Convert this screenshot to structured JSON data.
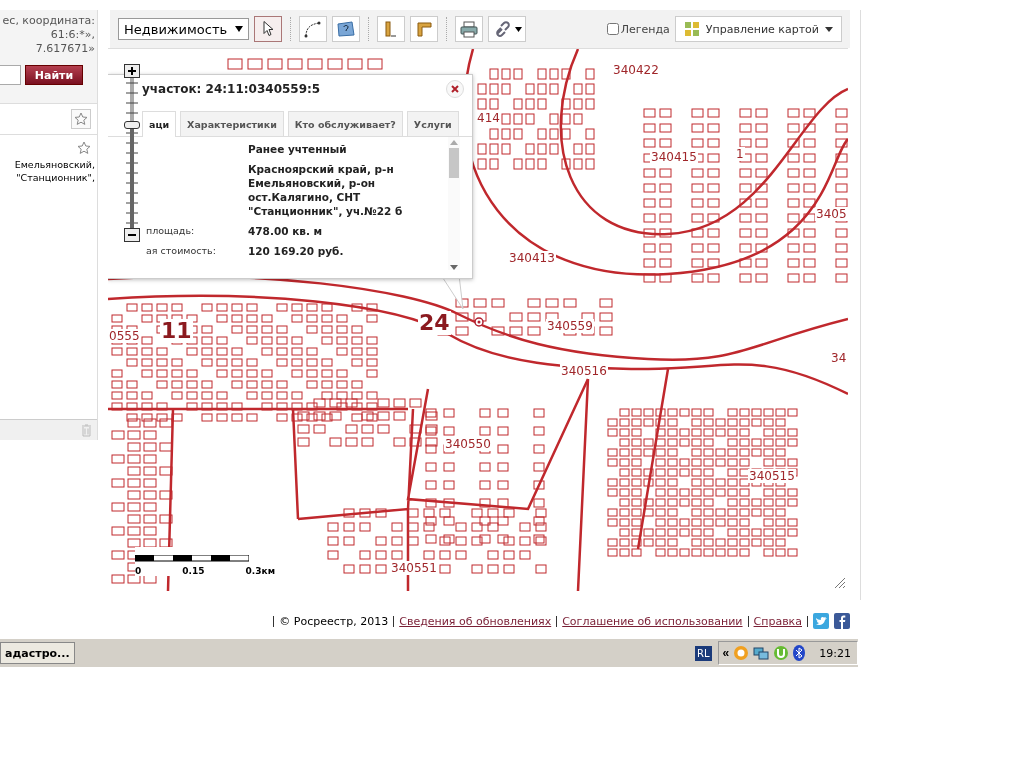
{
  "left_panel": {
    "hint_lines": [
      "ес, координата:",
      "61:6:*»,",
      "7.617671»"
    ],
    "search_button": "Найти",
    "result_lines": [
      "Емельяновский,",
      "\"Станционник\","
    ]
  },
  "toolbar": {
    "layer_select": "Недвижимость",
    "legend": {
      "label": "Легенда",
      "checked": false
    },
    "map_control": "Управление картой"
  },
  "map": {
    "labels": [
      {
        "text": "340422",
        "kind": "block"
      },
      {
        "text": "414",
        "kind": "block"
      },
      {
        "text": "340415",
        "kind": "block"
      },
      {
        "text": "1",
        "kind": "block"
      },
      {
        "text": "3405",
        "kind": "block"
      },
      {
        "text": "340413",
        "kind": "block"
      },
      {
        "text": "24",
        "kind": "district"
      },
      {
        "text": "0555",
        "kind": "block"
      },
      {
        "text": "11",
        "kind": "district"
      },
      {
        "text": "340559",
        "kind": "block"
      },
      {
        "text": "340516",
        "kind": "block"
      },
      {
        "text": "34",
        "kind": "block"
      },
      {
        "text": "340550",
        "kind": "block"
      },
      {
        "text": "340515",
        "kind": "block"
      },
      {
        "text": "340551",
        "kind": "block"
      }
    ],
    "scale": [
      "0",
      "0.15",
      "0.3км"
    ],
    "zoom": {
      "level": 0.7
    },
    "popup": {
      "title": "участок: 24:11:0340559:5",
      "tabs": [
        {
          "label": "аци",
          "selected": true
        },
        {
          "label": "Характеристики",
          "selected": false
        },
        {
          "label": "Кто обслуживает?",
          "selected": false
        },
        {
          "label": "Услуги",
          "selected": false
        }
      ],
      "rows": [
        {
          "label": "",
          "value": "Ранее учтенный"
        },
        {
          "label": "",
          "value": "Красноярский край, р-н Емельяновский, р-он ост.Калягино, СНТ \"Станционник\", уч.№22 б"
        },
        {
          "label": "площадь:",
          "value": "478.00 кв. м"
        },
        {
          "label": "ая стоимость:",
          "value": "120 169.20 руб."
        }
      ]
    }
  },
  "footer": {
    "copyright": "© Росреестр, 2013",
    "links": [
      "Сведения об обновлениях",
      "Соглашение об использовании",
      "Справка"
    ]
  },
  "taskbar": {
    "task": "адастро...",
    "lang": "RL",
    "tray_toggle": "«",
    "clock": "19:21"
  }
}
